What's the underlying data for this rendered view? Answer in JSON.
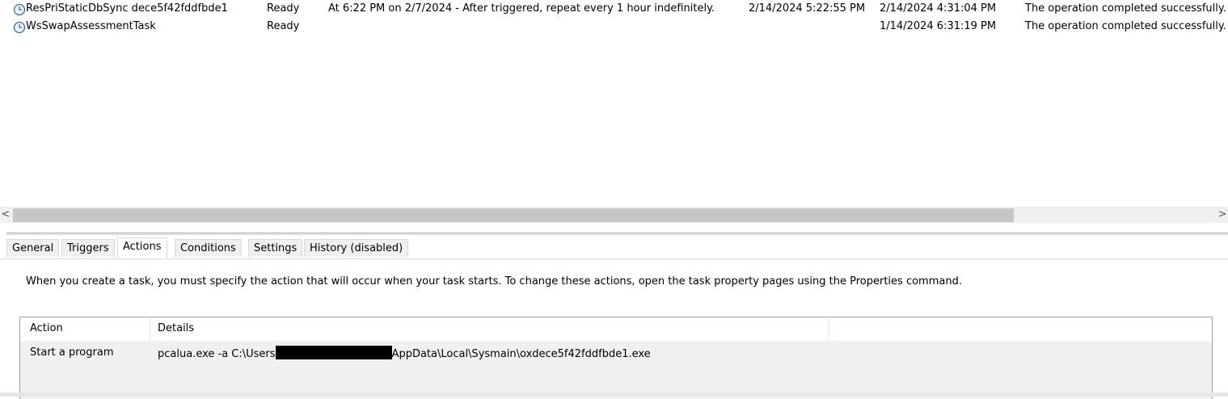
{
  "tasks": [
    {
      "name": "ResPriStaticDbSync dece5f42fddfbde1",
      "status": "Ready",
      "triggers": "At 6:22 PM on 2/7/2024 - After triggered, repeat every 1 hour indefinitely.",
      "next_run": "2/14/2024 5:22:55 PM",
      "last_run": "2/14/2024 4:31:04 PM",
      "last_result": "The operation completed successfully."
    },
    {
      "name": "WsSwapAssessmentTask",
      "status": "Ready",
      "triggers": "",
      "next_run": "",
      "last_run": "1/14/2024 6:31:19 PM",
      "last_result": "The operation completed successfully."
    }
  ],
  "scrollbar": {
    "left_arrow": "<",
    "right_arrow": ">"
  },
  "tabs": [
    {
      "label": "General",
      "active": false
    },
    {
      "label": "Triggers",
      "active": false
    },
    {
      "label": "Actions",
      "active": true
    },
    {
      "label": "Conditions",
      "active": false
    },
    {
      "label": "Settings",
      "active": false
    },
    {
      "label": "History (disabled)",
      "active": false
    }
  ],
  "actions_panel": {
    "description": "When you create a task, you must specify the action that will occur when your task starts.  To change these actions, open the task property pages using the Properties command.",
    "columns": [
      "Action",
      "Details"
    ],
    "rows": [
      {
        "action": "Start a program",
        "details_prefix": "pcalua.exe -a C:\\Users",
        "details_suffix": "AppData\\Local\\Sysmain\\oxdece5f42fddfbde1.exe"
      }
    ]
  },
  "icons": {
    "task_icon": "clock-icon"
  },
  "colors": {
    "panel_bg": "#f0f0f0",
    "redaction": "#000000"
  }
}
